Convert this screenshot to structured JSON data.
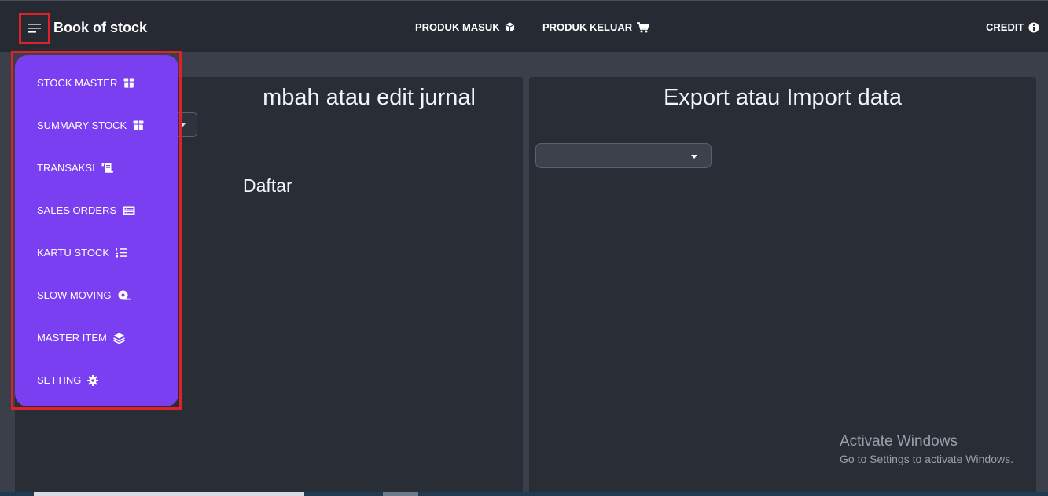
{
  "header": {
    "brand": "Book of stock",
    "nav": {
      "produk_masuk": "PRODUK MASUK",
      "produk_keluar": "PRODUK KELUAR",
      "credit": "CREDIT"
    }
  },
  "sidebar": {
    "items": [
      {
        "label": "STOCK MASTER",
        "icon": "box-icon"
      },
      {
        "label": "SUMMARY STOCK",
        "icon": "box-icon"
      },
      {
        "label": "TRANSAKSI",
        "icon": "scroll-icon"
      },
      {
        "label": "SALES ORDERS",
        "icon": "list-card-icon"
      },
      {
        "label": "KARTU STOCK",
        "icon": "numbered-list-icon"
      },
      {
        "label": "SLOW MOVING",
        "icon": "tape-icon"
      },
      {
        "label": "MASTER ITEM",
        "icon": "layers-icon"
      },
      {
        "label": "SETTING",
        "icon": "gear-icon"
      }
    ]
  },
  "main": {
    "left_panel": {
      "title": "Tambah atau edit jurnal",
      "title_visible": "mbah atau edit jurnal",
      "section_label": "Daftar"
    },
    "right_panel": {
      "title": "Export atau Import data"
    }
  },
  "watermark": {
    "title": "Activate Windows",
    "subtitle": "Go to Settings to activate Windows."
  },
  "colors": {
    "topbar": "#262a33",
    "background": "#3a3f4a",
    "panel": "#292d36",
    "menu_accent": "#7b3ff2",
    "highlight": "#e0212a"
  }
}
